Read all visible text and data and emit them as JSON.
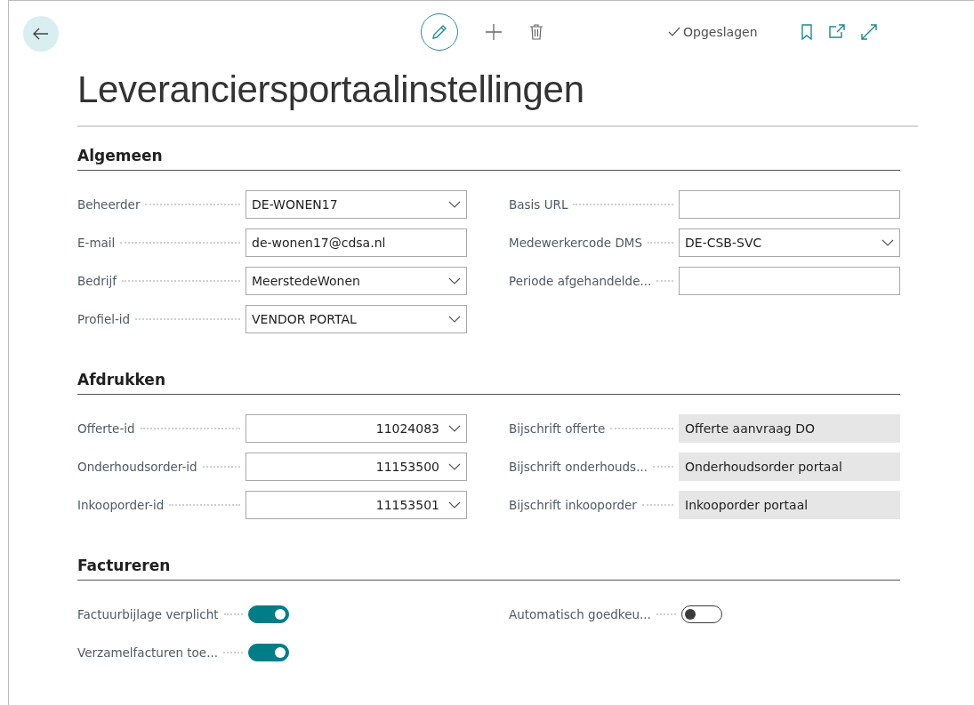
{
  "toolbar": {
    "status": "Opgeslagen"
  },
  "title": "Leveranciersportaalinstellingen",
  "sections": [
    {
      "heading": "Algemeen",
      "left": [
        {
          "label": "Beheerder",
          "kind": "dropdown",
          "value": "DE-WONEN17"
        },
        {
          "label": "E-mail",
          "kind": "text",
          "value": "de-wonen17@cdsa.nl"
        },
        {
          "label": "Bedrijf",
          "kind": "dropdown",
          "value": "MeerstedeWonen"
        },
        {
          "label": "Profiel-id",
          "kind": "dropdown",
          "value": "VENDOR PORTAL"
        }
      ],
      "right": [
        {
          "label": "Basis URL",
          "kind": "text"
        },
        {
          "label": "Medewerkercode DMS",
          "kind": "dropdown",
          "value": "DE-CSB-SVC"
        },
        {
          "label": "Periode afgehandelde...",
          "kind": "text"
        }
      ]
    },
    {
      "heading": "Afdrukken",
      "left": [
        {
          "label": "Offerte-id",
          "kind": "number-dropdown",
          "value": "11024083"
        },
        {
          "label": "Onderhoudsorder-id",
          "kind": "number-dropdown",
          "value": "11153500"
        },
        {
          "label": "Inkooporder-id",
          "kind": "number-dropdown",
          "value": "11153501"
        }
      ],
      "right": [
        {
          "label": "Bijschrift offerte",
          "kind": "readonly",
          "value": "Offerte aanvraag DO"
        },
        {
          "label": "Bijschrift onderhouds...",
          "kind": "readonly",
          "value": "Onderhoudsorder portaal"
        },
        {
          "label": "Bijschrift inkooporder",
          "kind": "readonly",
          "value": "Inkooporder portaal"
        }
      ]
    },
    {
      "heading": "Factureren",
      "left": [
        {
          "label": "Factuurbijlage verplicht",
          "kind": "toggle",
          "on": true
        },
        {
          "label": "Verzamelfacturen toe...",
          "kind": "toggle",
          "on": true
        }
      ],
      "right": [
        {
          "label": "Automatisch goedkeu...",
          "kind": "toggle",
          "on": false
        }
      ]
    }
  ]
}
